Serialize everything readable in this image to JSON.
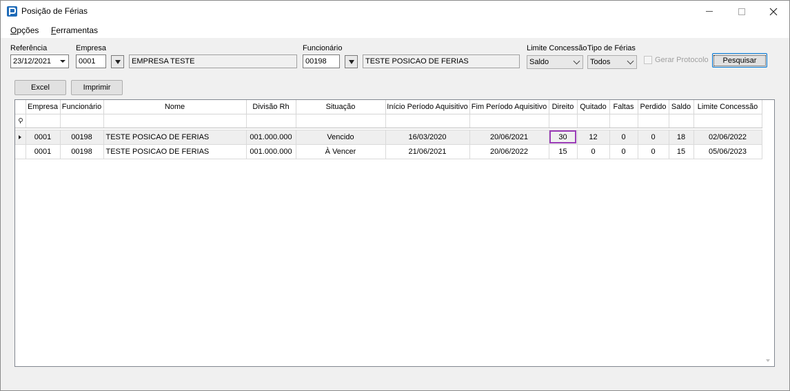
{
  "window": {
    "title": "Posição de Férias"
  },
  "menu": {
    "opcoes_first": "O",
    "opcoes_rest": "pções",
    "ferramentas_first": "F",
    "ferramentas_rest": "erramentas"
  },
  "filters": {
    "referencia_label": "Referência",
    "referencia_value": "23/12/2021",
    "empresa_label": "Empresa",
    "empresa_code": "0001",
    "empresa_name": "EMPRESA TESTE",
    "funcionario_label": "Funcionário",
    "funcionario_code": "00198",
    "funcionario_name": "TESTE POSICAO DE FERIAS",
    "limite_label": "Limite Concessão",
    "limite_value": "Saldo",
    "tipo_label": "Tipo de Férias",
    "tipo_value": "Todos",
    "gerar_protocolo_label": "Gerar Protocolo",
    "pesquisar_label": "Pesquisar"
  },
  "actions": {
    "excel_label": "Excel",
    "imprimir_label": "Imprimir"
  },
  "grid": {
    "columns": [
      "Empresa",
      "Funcionário",
      "Nome",
      "Divisão Rh",
      "Situação",
      "Início Período Aquisitivo",
      "Fim Período Aquisitivo",
      "Direito",
      "Quitado",
      "Faltas",
      "Perdido",
      "Saldo",
      "Limite Concessão"
    ],
    "rows": [
      [
        "0001",
        "00198",
        "TESTE POSICAO DE FERIAS",
        "001.000.000",
        "Vencido",
        "16/03/2020",
        "20/06/2021",
        "30",
        "12",
        "0",
        "0",
        "18",
        "02/06/2022"
      ],
      [
        "0001",
        "00198",
        "TESTE POSICAO DE FERIAS",
        "001.000.000",
        "À Vencer",
        "21/06/2021",
        "20/06/2022",
        "15",
        "0",
        "0",
        "0",
        "15",
        "05/06/2023"
      ]
    ]
  },
  "colors": {
    "focus_outline": "#9b3db8",
    "default_button_border": "#0078d7",
    "app_icon": "#1e6bb8"
  }
}
